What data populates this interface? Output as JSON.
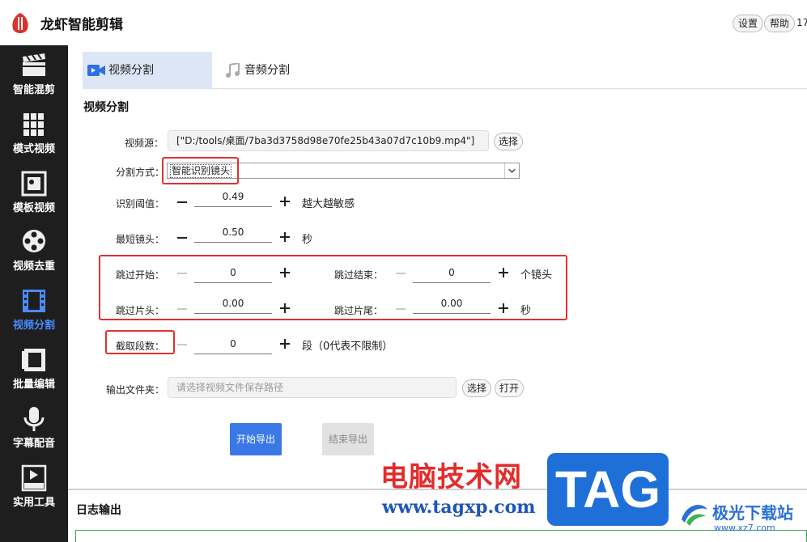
{
  "app": {
    "title": "龙虾智能剪辑"
  },
  "header": {
    "settings_label": "设置",
    "help_label": "帮助",
    "extra": "17"
  },
  "sidebar": {
    "items": [
      {
        "label": "智能混剪",
        "icon": "clapperboard-icon"
      },
      {
        "label": "模式视频",
        "icon": "books-icon"
      },
      {
        "label": "模板视频",
        "icon": "film-frame-icon"
      },
      {
        "label": "视频去重",
        "icon": "film-reel-icon"
      },
      {
        "label": "视频分割",
        "icon": "filmstrip-icon",
        "active": true
      },
      {
        "label": "批量编辑",
        "icon": "batch-film-icon"
      },
      {
        "label": "字幕配音",
        "icon": "microphone-icon"
      },
      {
        "label": "实用工具",
        "icon": "logo-tool-icon"
      }
    ]
  },
  "tabs": [
    {
      "label": "视频分割",
      "icon": "video-camera-icon",
      "active": true
    },
    {
      "label": "音频分割",
      "icon": "music-note-icon"
    }
  ],
  "section_title": "视频分割",
  "form": {
    "source": {
      "label": "视频源：",
      "value": "[\"D:/tools/桌面/7ba3d3758d98e70fe25b43a07d7c10b9.mp4\"]",
      "select_label": "选择"
    },
    "split_mode": {
      "label": "分割方式：",
      "value": "智能识别镜头"
    },
    "threshold": {
      "label": "识别阈值：",
      "value": "0.49",
      "unit": "越大越敏感"
    },
    "min_shot": {
      "label": "最短镜头：",
      "value": "0.50",
      "unit": "秒"
    },
    "skip_start": {
      "label": "跳过开始：",
      "value": "0"
    },
    "skip_end": {
      "label": "跳过结束：",
      "value": "0",
      "unit": "个镜头"
    },
    "skip_head": {
      "label": "跳过片头：",
      "value": "0.00"
    },
    "skip_tail": {
      "label": "跳过片尾：",
      "value": "0.00",
      "unit": "秒"
    },
    "segments": {
      "label": "截取段数：",
      "value": "0",
      "unit": "段（0代表不限制）"
    },
    "output": {
      "label": "输出文件夹：",
      "placeholder": "请选择视频文件保存路径",
      "select_label": "选择",
      "open_label": "打开"
    }
  },
  "actions": {
    "start_label": "开始导出",
    "stop_label": "结束导出"
  },
  "log": {
    "title": "日志输出"
  },
  "watermark": {
    "site_name": "电脑技术网",
    "url": "www.tagxp.com",
    "tag": "TAG",
    "brand": "极光下载站",
    "brand_url": "www.xz7.com"
  },
  "colors": {
    "accent": "#3b78e7",
    "sidebar_bg": "#1e1e1e",
    "highlight_red": "#e0312f",
    "active_tab_bg": "#dde6f4"
  }
}
